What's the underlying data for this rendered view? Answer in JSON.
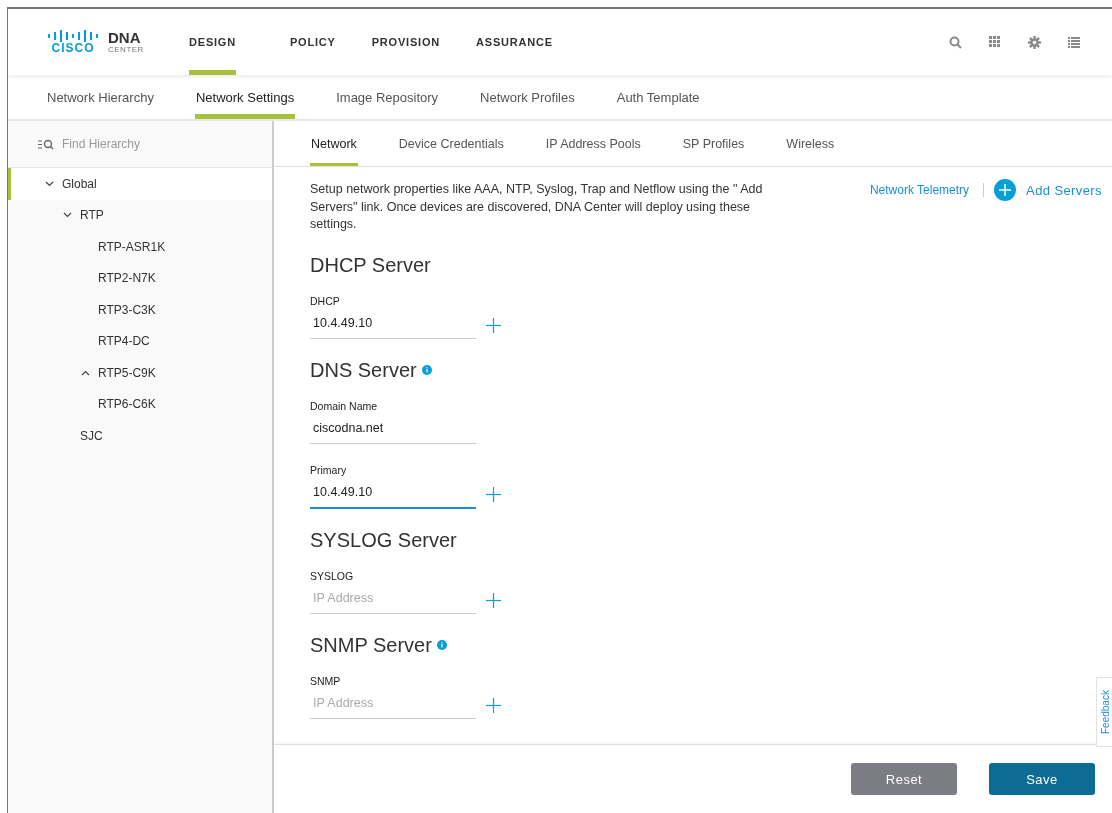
{
  "header": {
    "logo_brand": "CISCO",
    "logo_product": "DNA",
    "logo_sub": "CENTER",
    "nav": [
      {
        "label": "DESIGN",
        "selected": true
      },
      {
        "label": "POLICY",
        "selected": false
      },
      {
        "label": "PROVISION",
        "selected": false
      },
      {
        "label": "ASSURANCE",
        "selected": false
      }
    ]
  },
  "subtabs": [
    {
      "label": "Network Hierarchy",
      "selected": false
    },
    {
      "label": "Network Settings",
      "selected": true
    },
    {
      "label": "Image Repository",
      "selected": false
    },
    {
      "label": "Network Profiles",
      "selected": false
    },
    {
      "label": "Auth Template",
      "selected": false
    }
  ],
  "sidebar": {
    "search": {
      "placeholder": "Find Hierarchy"
    },
    "tree": [
      {
        "label": "Global",
        "selected": true,
        "expanded": true,
        "children": [
          {
            "label": "RTP",
            "selected": false,
            "expanded": true,
            "children": [
              {
                "label": "RTP-ASR1K",
                "selected": false
              },
              {
                "label": "RTP2-N7K",
                "selected": false
              },
              {
                "label": "RTP3-C3K",
                "selected": false
              },
              {
                "label": "RTP4-DC",
                "selected": false
              },
              {
                "label": "RTP5-C9K",
                "selected": false,
                "expanded": false
              },
              {
                "label": "RTP6-C6K",
                "selected": false
              }
            ]
          },
          {
            "label": "SJC",
            "selected": false
          }
        ]
      }
    ]
  },
  "content_tabs": [
    {
      "label": "Network",
      "selected": true
    },
    {
      "label": "Device Credentials",
      "selected": false
    },
    {
      "label": "IP Address Pools",
      "selected": false
    },
    {
      "label": "SP Profiles",
      "selected": false
    },
    {
      "label": "Wireless",
      "selected": false
    }
  ],
  "intro": "Setup network properties like AAA, NTP, Syslog, Trap and Netflow using the \" Add Servers\" link. Once devices are discovered, DNA Center will deploy using these settings.",
  "telemetry_link": "Network Telemetry",
  "add_servers": "Add Servers",
  "sections": [
    {
      "title": "DHCP Server",
      "info": false,
      "fields": [
        {
          "label": "DHCP",
          "value": "10.4.49.10",
          "focused": false,
          "addable": true
        }
      ]
    },
    {
      "title": "DNS Server",
      "info": true,
      "fields": [
        {
          "label": "Domain Name",
          "value": "ciscodna.net",
          "focused": false,
          "addable": false
        },
        {
          "label": "Primary",
          "value": "10.4.49.10",
          "focused": true,
          "addable": true
        }
      ]
    },
    {
      "title": "SYSLOG Server",
      "info": false,
      "fields": [
        {
          "label": "SYSLOG",
          "placeholder": "IP Address",
          "focused": false,
          "addable": true
        }
      ]
    },
    {
      "title": "SNMP Server",
      "info": true,
      "fields": [
        {
          "label": "SNMP",
          "placeholder": "IP Address",
          "focused": false,
          "addable": true
        }
      ]
    }
  ],
  "feedback": "Feedback",
  "buttons": [
    {
      "label": "Reset",
      "kind": "secondary"
    },
    {
      "label": "Save",
      "kind": "primary"
    }
  ]
}
